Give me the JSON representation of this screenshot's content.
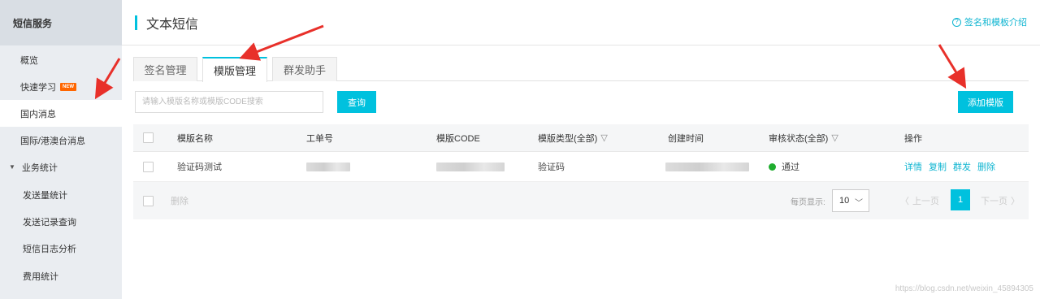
{
  "sidebar": {
    "title": "短信服务",
    "items": [
      {
        "label": "概览"
      },
      {
        "label": "快速学习",
        "badge": "NEW"
      },
      {
        "label": "国内消息"
      },
      {
        "label": "国际/港澳台消息"
      },
      {
        "label": "业务统计"
      },
      {
        "label": "发送量统计"
      },
      {
        "label": "发送记录查询"
      },
      {
        "label": "短信日志分析"
      },
      {
        "label": "费用统计"
      }
    ]
  },
  "header": {
    "title": "文本短信",
    "help_link": "签名和模板介绍"
  },
  "tabs": [
    {
      "label": "签名管理"
    },
    {
      "label": "模版管理"
    },
    {
      "label": "群发助手"
    }
  ],
  "toolbar": {
    "search_placeholder": "请输入模版名称或模版CODE搜索",
    "search_button": "查询",
    "add_button": "添加模版"
  },
  "table": {
    "headers": [
      "模版名称",
      "工单号",
      "模版CODE",
      "模版类型(全部)",
      "创建时间",
      "审核状态(全部)",
      "操作"
    ],
    "rows": [
      {
        "name": "验证码测试",
        "type": "验证码",
        "status": "通过",
        "actions": [
          "详情",
          "复制",
          "群发",
          "删除"
        ]
      }
    ],
    "footer": {
      "delete": "删除",
      "per_page_label": "每页显示:",
      "per_page_value": "10",
      "prev": "上一页",
      "page": "1",
      "next": "下一页"
    }
  },
  "watermark": "https://blog.csdn.net/weixin_45894305",
  "colors": {
    "accent": "#00c1de",
    "link": "#0fb5d1",
    "status_ok": "#1fad2e",
    "annotation": "#e8302a"
  }
}
